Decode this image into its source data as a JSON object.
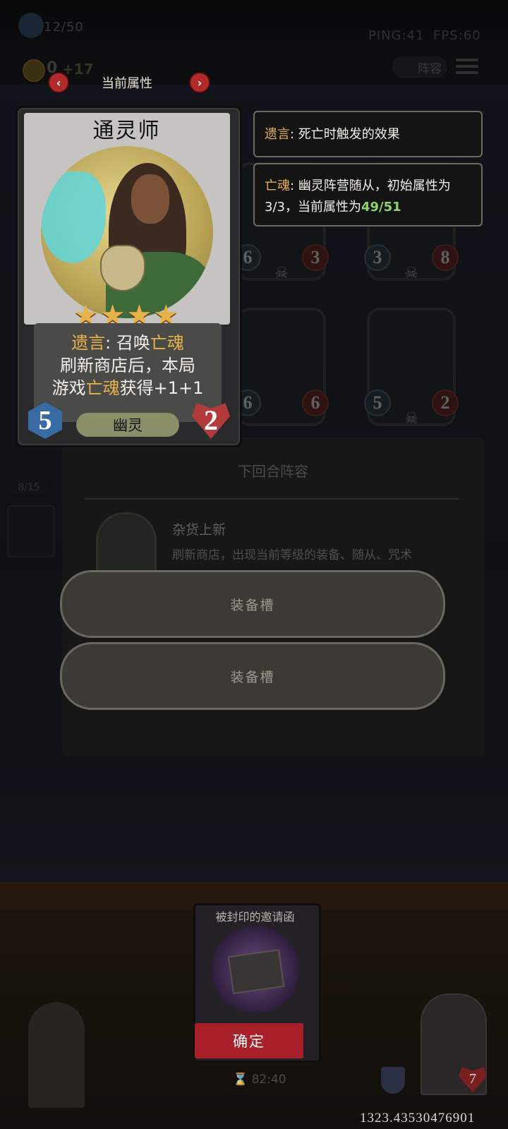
{
  "hud": {
    "energy": "12/50",
    "ping": "PING:41",
    "fps": "FPS:60",
    "gold": "0",
    "gold_gain": "+17",
    "lineup_label": "阵容"
  },
  "board": {
    "cards": [
      {
        "atk": "6",
        "hp": "3"
      },
      {
        "atk": "3",
        "hp": "8"
      },
      {
        "atk": "6",
        "hp": "6"
      },
      {
        "atk": "5",
        "hp": "2"
      }
    ],
    "queue_count": "8/15"
  },
  "nav": {
    "title": "当前属性"
  },
  "hero_card": {
    "name": "通灵师",
    "stars": "★★★★",
    "desc_line1_prefix": "遗言",
    "desc_line1_mid": ": 召唤",
    "desc_line1_key": "亡魂",
    "desc_line2": "刷新商店后，本局",
    "desc_line3_prefix": "游戏",
    "desc_line3_key": "亡魂",
    "desc_line3_suffix": "获得+1+1",
    "attack": "5",
    "health": "2",
    "tribe": "幽灵"
  },
  "tooltips": {
    "deathrattle_key": "遗言",
    "deathrattle_text": ": 死亡时触发的效果",
    "soul_key": "亡魂",
    "soul_text1": ": 幽灵阵营随从，初始属性为",
    "soul_text2": "3/3，当前属性为",
    "soul_current": "49/51"
  },
  "panel": {
    "title": "下回合阵容",
    "item_title": "杂货上新",
    "item_desc": "刷新商店，出现当前等级的装备、随从、咒术",
    "equip_slot_1": "装备槽",
    "equip_slot_2": "装备槽"
  },
  "bottom": {
    "invite_title": "被封印的邀请函",
    "confirm_label": "确定",
    "timer": "82:40",
    "life": "7",
    "coords": "1323.43530476901"
  },
  "colors": {
    "highlight": "#e8b24a",
    "confirm_red": "#a8212a",
    "value_green": "#8fd46a"
  }
}
